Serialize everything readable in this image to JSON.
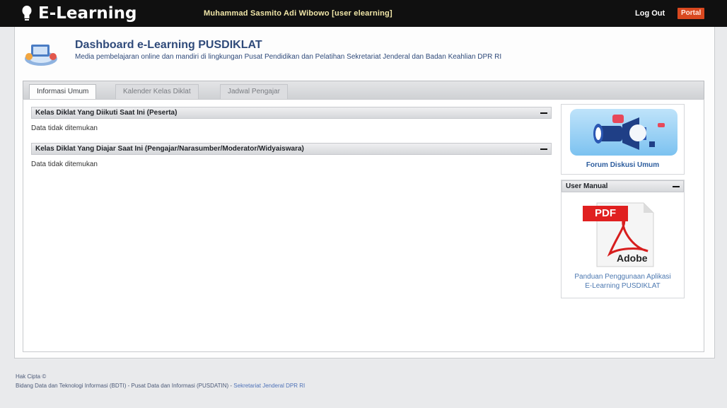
{
  "topbar": {
    "brand": "E-Learning",
    "user": "Muhammad Sasmito Adi Wibowo [user elearning]",
    "logout": "Log Out",
    "portal": "Portal"
  },
  "header": {
    "title": "Dashboard e-Learning PUSDIKLAT",
    "subtitle": "Media pembelajaran online dan mandiri di lingkungan Pusat Pendidikan dan Pelatihan Sekretariat Jenderal dan Badan Keahlian DPR RI"
  },
  "tabs": [
    {
      "label": "Informasi Umum",
      "active": true
    },
    {
      "label": "Kalender Kelas Diklat",
      "active": false
    },
    {
      "label": "Jadwal Pengajar",
      "active": false
    }
  ],
  "panels": [
    {
      "title": "Kelas Diklat Yang Diikuti Saat Ini (Peserta)",
      "body": "Data tidak ditemukan"
    },
    {
      "title": "Kelas Diklat Yang Diajar Saat Ini (Pengajar/Narasumber/Moderator/Widyaiswara)",
      "body": "Data tidak ditemukan"
    }
  ],
  "sidebar": {
    "forum_label": "Forum Diskusi Umum",
    "manual_title": "User Manual",
    "pdf_label": "PDF",
    "adobe_label": "Adobe",
    "manual_link": "Panduan Penggunaan Aplikasi E-Learning PUSDIKLAT"
  },
  "footer": {
    "copyright": "Hak Cipta ©",
    "line_part1": "Bidang Data dan Teknologi Informasi (BDTI) - Pusat Data dan Informasi (PUSDATIN) - ",
    "line_link": "Sekretariat Jenderal DPR RI"
  },
  "colors": {
    "topbar": "#101010",
    "portal": "#d9481f",
    "title": "#2f4a7a",
    "link": "#2d5d9e"
  }
}
